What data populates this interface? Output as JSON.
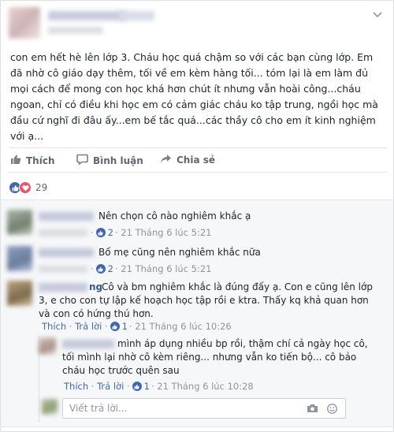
{
  "post": {
    "text": "con em hết hè lên lớp 3. Cháu học quá chậm so với các bạn cùng lớp. Em đã nhờ cô giáo dạy thêm, tối về em kèm hàng tối... tóm lại là em làm đủ mọi cách để mong con học khá hơn chút ít nhưng vẫn hoài công...cháu ngoan, chỉ có điều khi học em có cảm giác cháu ko tập trung, ngồi học mà đầu cứ nghĩ đi đâu ấy...em bế tắc quá...các thầy cô cho em ít kinh nghiệm với ạ..."
  },
  "actions": {
    "like_label": "Thích",
    "comment_label": "Bình luận",
    "share_label": "Chia sẻ"
  },
  "reactions": {
    "count": "29"
  },
  "comments": [
    {
      "text": "Nên chọn cô nào nghiêm khắc ạ",
      "like_count": "2",
      "time": "21 Tháng 6 lúc 5:21"
    },
    {
      "text": "Bố mẹ cũng nên nghiêm khắc nữa",
      "like_count": "2",
      "time": "21 Tháng 6 lúc 5:21"
    },
    {
      "name_tail": "ng",
      "text": "Cô và bm nghiêm khắc là đúng đấy ạ. Con e cũng lên lớp 3, e cho con tự lập kế hoạch học tập rồi e ktra. Thấy kq khả quan hơn và con có hứng thú hơn.",
      "like_label": "Thích",
      "reply_label": "Trả lời",
      "like_count": "1",
      "time": "21 Tháng 6 lúc 10:26"
    }
  ],
  "reply": {
    "text": "mình áp dụng nhiều bp rồi, thậm chí cả ngày học cô, tối mình lại nhờ cô kèm riêng... nhưng vẫn ko tiến bộ... cô bảo cháu học trước quên sau",
    "like_label": "Thích",
    "reply_label": "Trả lời",
    "like_count": "1",
    "time": "21 Tháng 6 lúc 10:28"
  },
  "reply_input": {
    "placeholder": "Viết trả lời..."
  },
  "colors": {
    "link": "#4267b2",
    "meta": "#90949c",
    "love": "#f25268"
  },
  "icons": [
    "thumbs-up-icon",
    "comment-icon",
    "share-icon",
    "camera-icon",
    "smiley-icon",
    "heart-icon"
  ]
}
